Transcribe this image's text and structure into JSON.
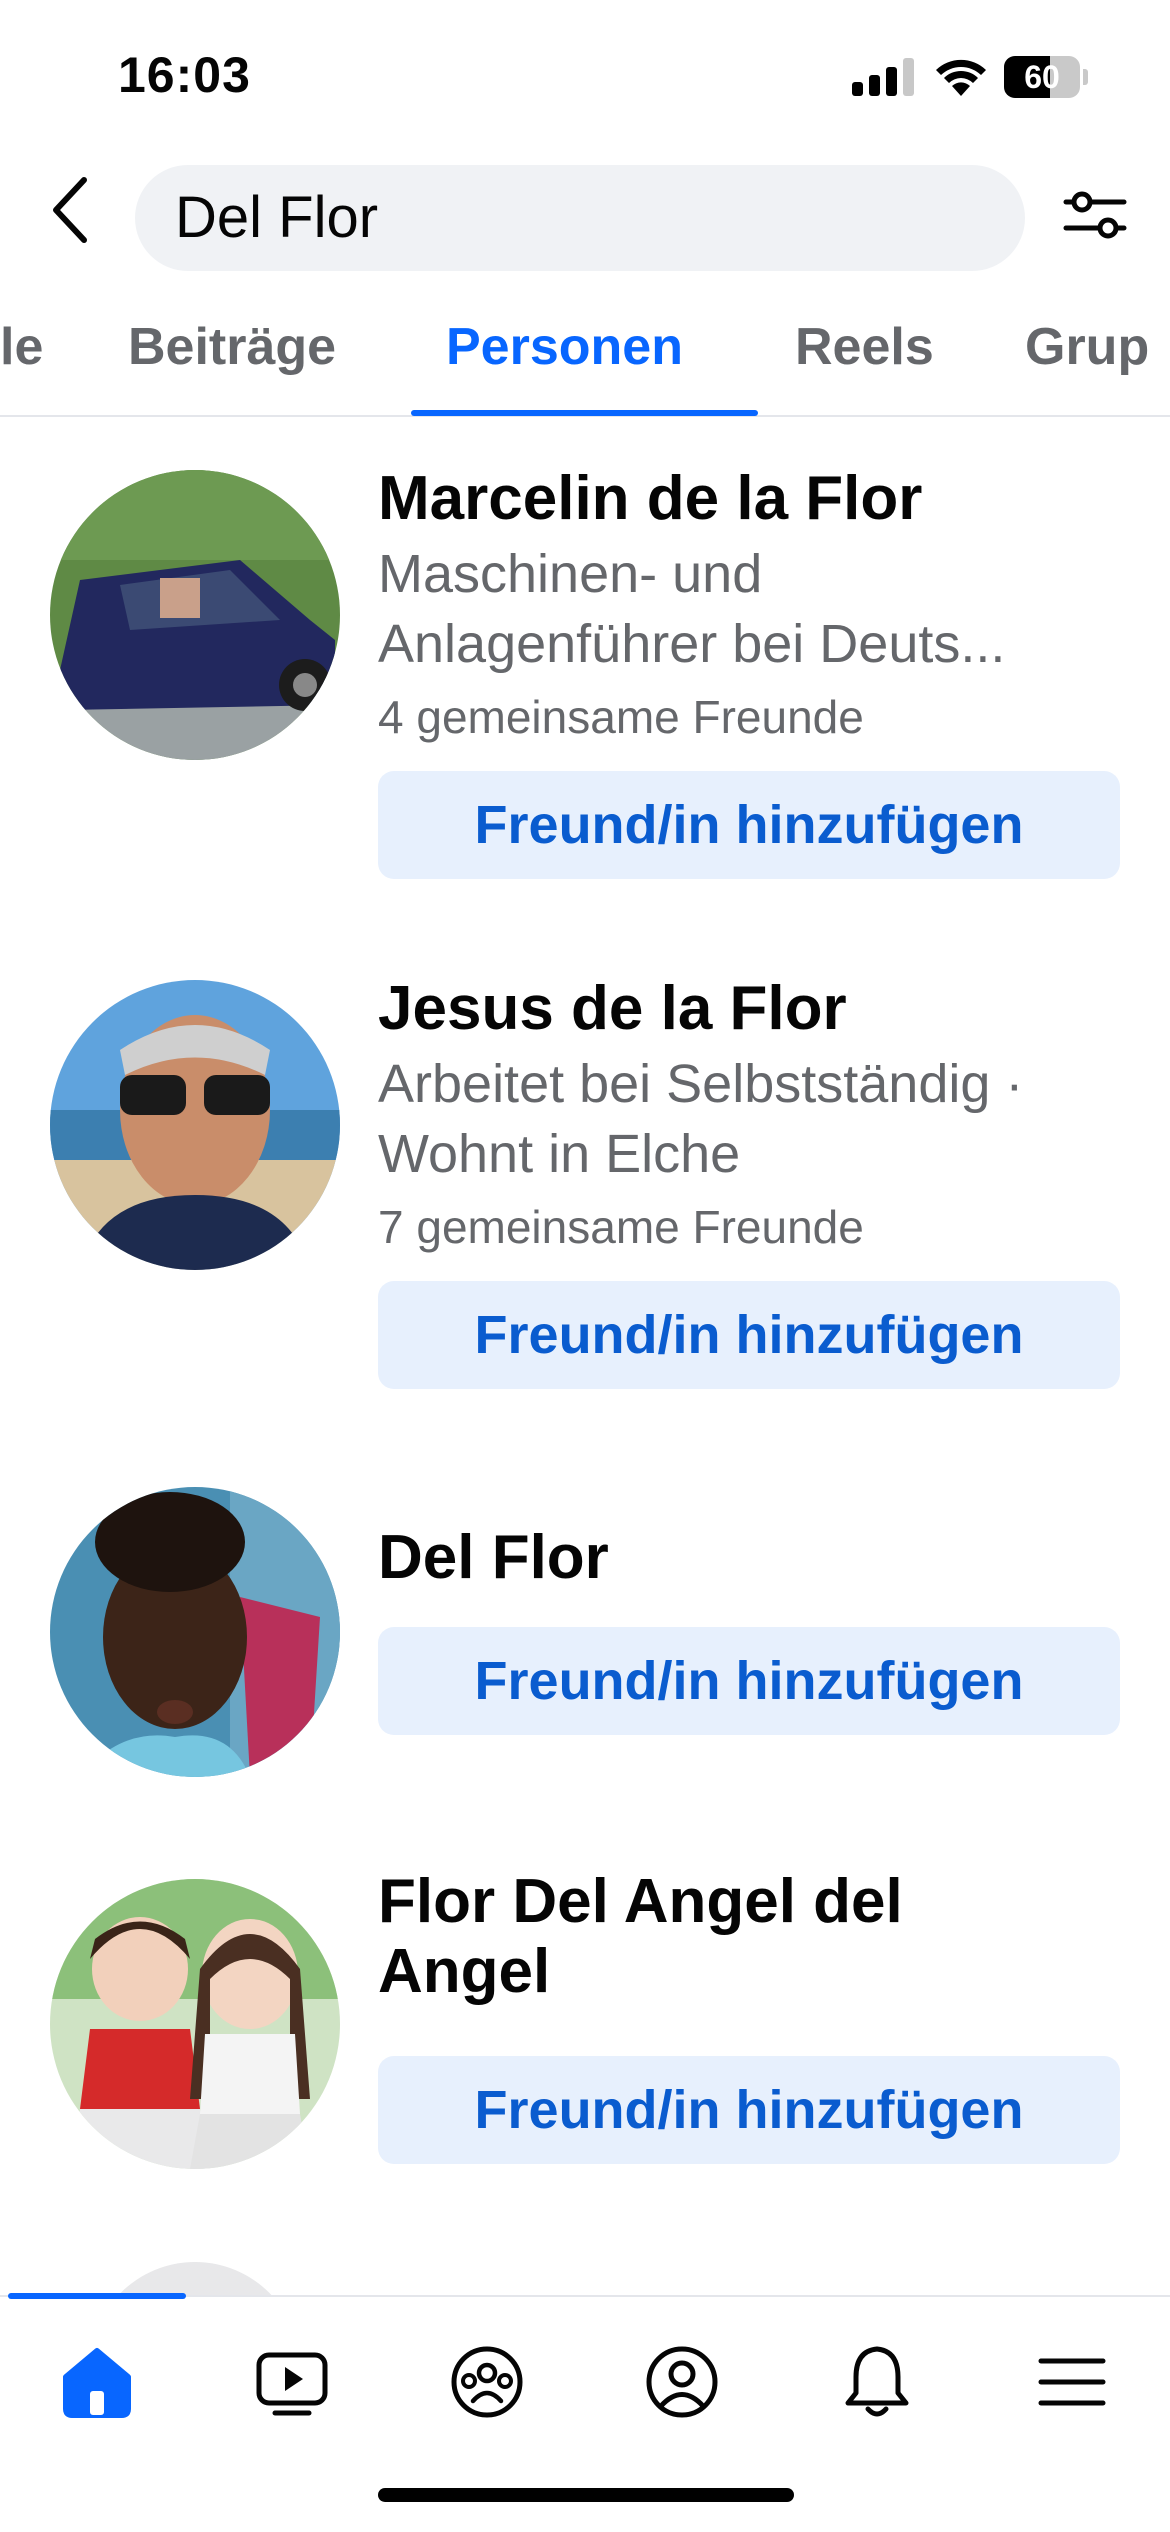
{
  "status_bar": {
    "time": "16:03",
    "battery": "60",
    "battery_level": 0.6
  },
  "search": {
    "query": "Del Flor",
    "back_icon": "chevron-left-icon",
    "filter_icon": "sliders-icon"
  },
  "tabs": [
    {
      "label": "le",
      "active": false
    },
    {
      "label": "Beiträge",
      "active": false
    },
    {
      "label": "Personen",
      "active": true
    },
    {
      "label": "Reels",
      "active": false
    },
    {
      "label": "Grup",
      "active": false
    }
  ],
  "results": [
    {
      "name": "Marcelin de la Flor",
      "lines": [
        "Maschinen- und",
        "Anlagenführer bei Deuts..."
      ],
      "mutual": "4 gemeinsame Freunde",
      "button": "Freund/in hinzufügen"
    },
    {
      "name": "Jesus de la Flor",
      "lines": [
        "Arbeitet bei Selbstständig ·",
        "Wohnt in Elche"
      ],
      "mutual": "7 gemeinsame Freunde",
      "button": "Freund/in hinzufügen"
    },
    {
      "name": "Del Flor",
      "button": "Freund/in hinzufügen"
    },
    {
      "name_lines": [
        "Flor Del Angel del",
        "Angel"
      ],
      "button": "Freund/in hinzufügen"
    }
  ],
  "bottom_nav": [
    {
      "icon": "home-icon",
      "active": true
    },
    {
      "icon": "video-icon",
      "active": false
    },
    {
      "icon": "groups-icon",
      "active": false
    },
    {
      "icon": "profile-icon",
      "active": false
    },
    {
      "icon": "bell-icon",
      "active": false
    },
    {
      "icon": "menu-icon",
      "active": false
    }
  ],
  "colors": {
    "accent": "#0866ff",
    "button_bg": "#e7f0fd",
    "button_text": "#0a5ccf",
    "secondary_text": "#65676b"
  }
}
